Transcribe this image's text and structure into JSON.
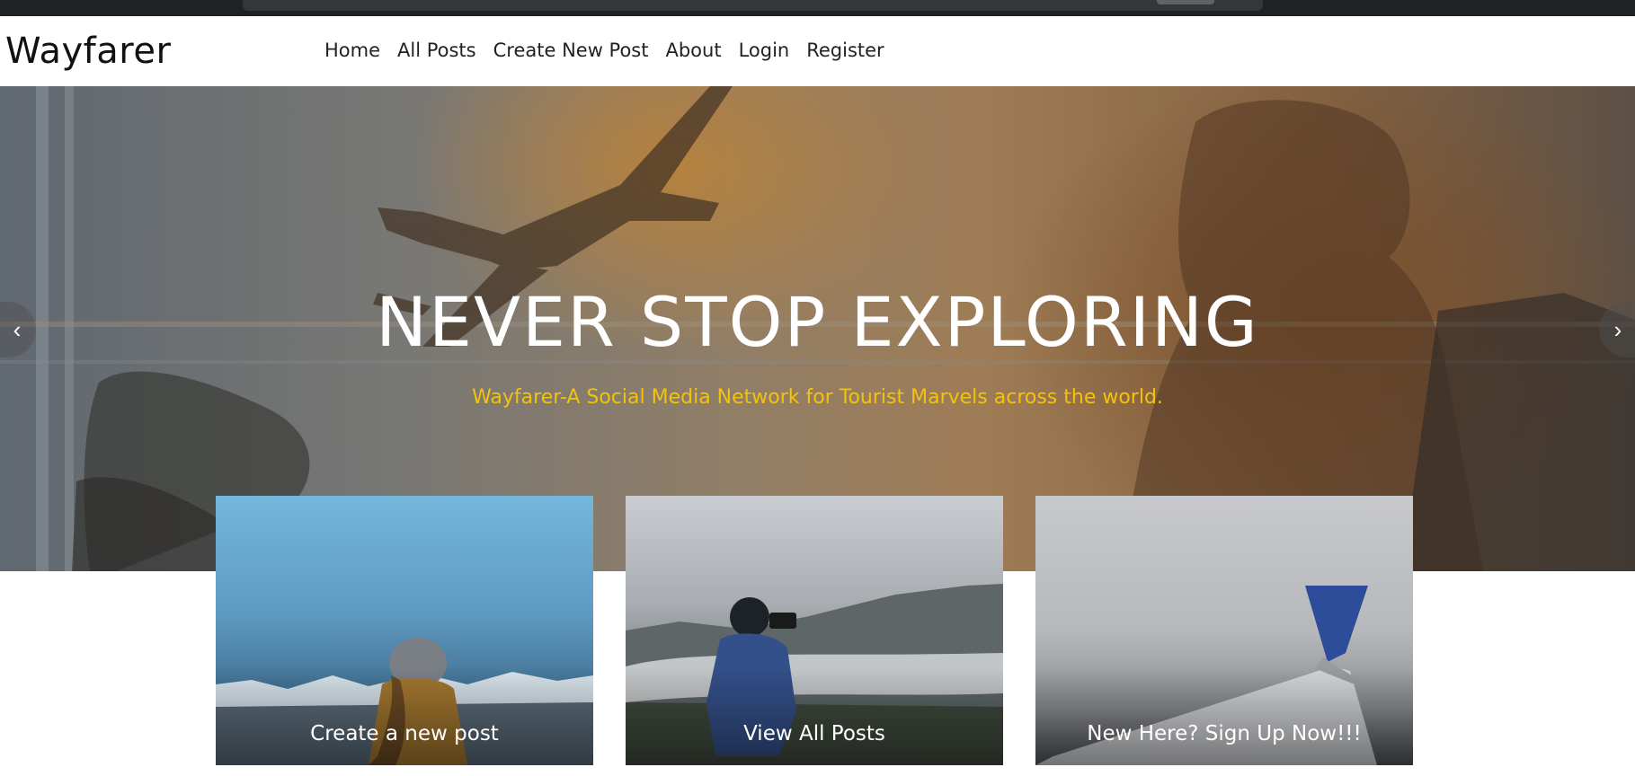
{
  "site": {
    "brand": "Wayfarer"
  },
  "nav": {
    "links": [
      {
        "label": "Home"
      },
      {
        "label": "All Posts"
      },
      {
        "label": "Create New Post"
      },
      {
        "label": "About"
      },
      {
        "label": "Login"
      },
      {
        "label": "Register"
      }
    ]
  },
  "hero": {
    "title": "NEVER STOP EXPLORING",
    "subtitle": "Wayfarer-A Social Media Network for Tourist Marvels across the world.",
    "prev_icon": "chevron-left-icon",
    "next_icon": "chevron-right-icon"
  },
  "cards": [
    {
      "label": "Create a new post"
    },
    {
      "label": "View All Posts"
    },
    {
      "label": "New Here? Sign Up Now!!!"
    }
  ],
  "colors": {
    "subtitle": "#f2c30e",
    "title": "#ffffff",
    "brand_text": "#111111"
  }
}
